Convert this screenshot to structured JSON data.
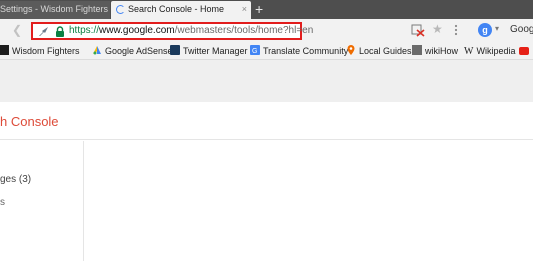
{
  "tabs": [
    {
      "title": "Settings - Wisdom Fighters",
      "close": "×",
      "active": false
    },
    {
      "title": "Search Console - Home",
      "close": "×",
      "active": true
    }
  ],
  "new_tab": "+",
  "toolbar": {
    "back": "❮",
    "url_scheme": "https://",
    "url_domain": "www.google.com",
    "url_path": "/webmasters/tools/home?hl=en",
    "star": "★",
    "profile_initial": "g",
    "profile_caret": "▾",
    "profile_text": "Goog"
  },
  "bookmarks": [
    {
      "label": "Wisdom Fighters",
      "icon": "wisdom-fighters-icon"
    },
    {
      "label": "Google AdSense",
      "icon": "adsense-icon"
    },
    {
      "label": "Twitter Manager",
      "icon": "twitter-icon"
    },
    {
      "label": "Translate Community",
      "icon": "translate-icon"
    },
    {
      "label": "Local Guides",
      "icon": "local-guides-icon"
    },
    {
      "label": "wikiHow",
      "icon": "wikihow-icon"
    },
    {
      "label": "Wikipedia",
      "icon": "wikipedia-icon"
    }
  ],
  "page": {
    "title": "h Console",
    "sidebar_item": "ges (3)",
    "sidebar_bullet": "s"
  },
  "colors": {
    "highlight": "#e21d1d",
    "title_red": "#dd4b39",
    "secure_green": "#0b8043"
  }
}
